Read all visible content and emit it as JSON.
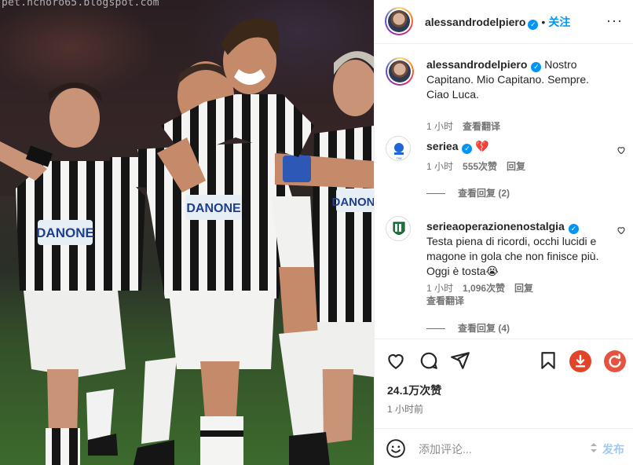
{
  "photo": {
    "watermark": "pet.ncnoro65.blogspot.com",
    "shirt_sponsor": "DANONE"
  },
  "header": {
    "username": "alessandrodelpiero",
    "separator": "•",
    "follow_label": "关注",
    "more_label": "···"
  },
  "caption": {
    "username": "alessandrodelpiero",
    "text": "Nostro Capitano. Mio Capitano. Sempre. Ciao Luca.",
    "time": "1 小时",
    "translate": "查看翻译"
  },
  "comments": [
    {
      "username": "seriea",
      "text": "💔",
      "time": "1 小时",
      "likes": "555次赞",
      "reply": "回复",
      "view_replies": "查看回复 (2)"
    },
    {
      "username": "serieaoperazionenostalgia",
      "text": "Testa piena di ricordi, occhi lucidi e magone in gola che non finisce più. Oggi è tosta😭",
      "time": "1 小时",
      "likes": "1,096次赞",
      "reply": "回复",
      "translate": "查看翻译",
      "view_replies": "查看回复 (4)"
    }
  ],
  "actions": {
    "likes": "24.1万次赞",
    "time": "1 小时前"
  },
  "composer": {
    "placeholder": "添加评论...",
    "post_label": "发布"
  },
  "colors": {
    "accent": "#0095f6",
    "secondary_text": "#737373",
    "download_button": "#e0452a",
    "refresh_button": "#e55340"
  }
}
